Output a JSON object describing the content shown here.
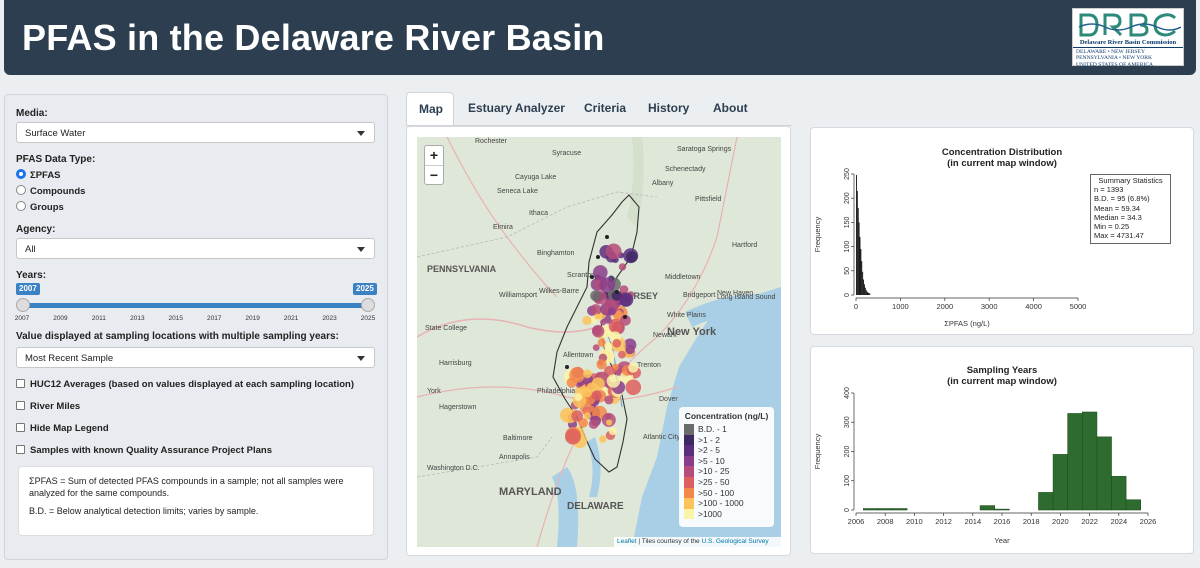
{
  "header": {
    "title": "PFAS in the Delaware River Basin",
    "logo": {
      "name": "Delaware River Basin Commission",
      "states_line1": "DELAWARE • NEW JERSEY",
      "states_line2": "PENNSYLVANIA • NEW YORK",
      "states_line3": "UNITED STATES OF AMERICA"
    }
  },
  "sidebar": {
    "media_label": "Media:",
    "media_value": "Surface Water",
    "data_type_label": "PFAS Data Type:",
    "data_type_options": [
      "ΣPFAS",
      "Compounds",
      "Groups"
    ],
    "data_type_selected": "ΣPFAS",
    "agency_label": "Agency:",
    "agency_value": "All",
    "years_label": "Years:",
    "years_min": "2007",
    "years_max": "2025",
    "years_ticks": [
      "2007",
      "2009",
      "2011",
      "2013",
      "2015",
      "2017",
      "2019",
      "2021",
      "2023",
      "2025"
    ],
    "multi_year_label": "Value displayed at sampling locations with multiple sampling years:",
    "multi_year_value": "Most Recent Sample",
    "checkboxes": [
      "HUC12 Averages (based on values displayed at each sampling location)",
      "River Miles",
      "Hide Map Legend",
      "Samples with known Quality Assurance Project Plans"
    ],
    "note1": "ΣPFAS = Sum of detected PFAS compounds in a sample; not all samples were analyzed for the same compounds.",
    "note2": "B.D. = Below analytical detection limits; varies by sample."
  },
  "tabs": [
    "Map",
    "Estuary Analyzer",
    "Criteria",
    "History",
    "About"
  ],
  "active_tab": "Map",
  "map": {
    "zoom_in": "+",
    "zoom_out": "−",
    "legend_title": "Concentration (ng/L)",
    "legend": [
      {
        "label": "B.D. - 1",
        "color": "#6b6b6b"
      },
      {
        "label": ">1 - 2",
        "color": "#3d2a64"
      },
      {
        "label": ">2 - 5",
        "color": "#5b2e7e"
      },
      {
        "label": ">5 - 10",
        "color": "#8a3d8b"
      },
      {
        "label": ">10 - 25",
        "color": "#b54c7a"
      },
      {
        "label": ">25 - 50",
        "color": "#dd5f5f"
      },
      {
        "label": ">50 - 100",
        "color": "#f3874a"
      },
      {
        "label": ">100 - 1000",
        "color": "#fbc35a"
      },
      {
        "label": ">1000",
        "color": "#fbf3a8"
      }
    ],
    "attribution_link": "Leaflet",
    "attribution_text": " | Tiles courtesy of the ",
    "attribution_link2": "U.S. Geological Survey",
    "place_labels": [
      "Rochester",
      "Syracuse",
      "Saratoga Springs",
      "Schenectady",
      "Cayuga Lake",
      "Seneca Lake",
      "Albany",
      "Ithaca",
      "Elmira",
      "Binghamton",
      "Pittsfield",
      "Hartford",
      "Middletown",
      "New Haven",
      "PENNSYLVANIA",
      "Scranton",
      "Wilkes-Barre",
      "NEW JERSEY",
      "Bridgeport",
      "Long Island Sound",
      "Williamsport",
      "White Plains",
      "New York",
      "State College",
      "Newark",
      "Harrisburg",
      "Allentown",
      "Trenton",
      "York",
      "Philadelphia",
      "Hagerstown",
      "Dover",
      "Baltimore",
      "Atlantic City",
      "Washington D.C.",
      "Annapolis",
      "MARYLAND",
      "DELAWARE"
    ]
  },
  "charts": {
    "distribution_title": "Concentration Distribution",
    "distribution_subtitle": "(in current map window)",
    "stats_title": "Summary Statistics",
    "stats_lines": [
      "n = 1393",
      "B.D. = 95 (6.8%)",
      "Mean = 59.34",
      "Median = 34.3",
      "Min = 0.25",
      "Max = 4731.47"
    ],
    "years_title": "Sampling Years",
    "years_subtitle": "(in current map window)"
  },
  "chart_data": [
    {
      "type": "bar",
      "title": "Concentration Distribution",
      "subtitle": "(in current map window)",
      "xlabel": "ΣPFAS (ng/L)",
      "ylabel": "Frequency",
      "xlim": [
        0,
        5000
      ],
      "ylim": [
        0,
        250
      ],
      "xticks": [
        0,
        1000,
        2000,
        3000,
        4000,
        5000
      ],
      "yticks": [
        0,
        50,
        100,
        150,
        200,
        250
      ],
      "bin_width": 20,
      "x": [
        0,
        20,
        40,
        60,
        80,
        100,
        120,
        140,
        160,
        180,
        200,
        220,
        240,
        260,
        280,
        300
      ],
      "values": [
        248,
        215,
        180,
        150,
        120,
        95,
        70,
        48,
        32,
        22,
        15,
        10,
        7,
        5,
        4,
        3
      ]
    },
    {
      "type": "bar",
      "title": "Sampling Years",
      "subtitle": "(in current map window)",
      "xlabel": "Year",
      "ylabel": "Frequency",
      "xlim": [
        2006,
        2026
      ],
      "ylim": [
        0,
        400
      ],
      "xticks": [
        2006,
        2008,
        2010,
        2012,
        2014,
        2016,
        2018,
        2020,
        2022,
        2024,
        2026
      ],
      "yticks": [
        0,
        100,
        200,
        300,
        400
      ],
      "categories": [
        2007,
        2008,
        2009,
        2015,
        2016,
        2019,
        2020,
        2021,
        2022,
        2023,
        2024,
        2025
      ],
      "values": [
        5,
        5,
        5,
        15,
        3,
        60,
        190,
        330,
        335,
        250,
        115,
        35
      ]
    }
  ]
}
